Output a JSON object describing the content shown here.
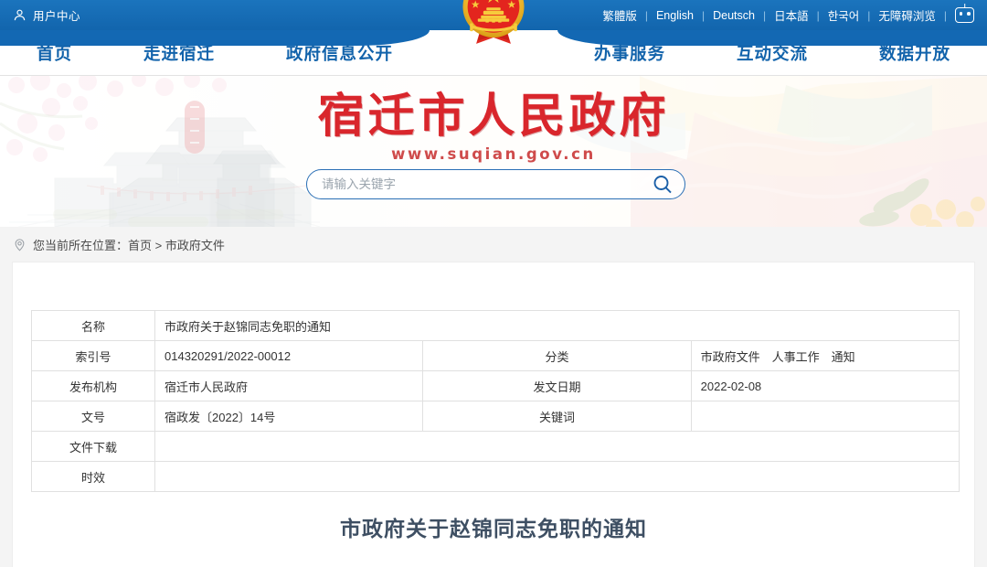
{
  "topbar": {
    "user_center": "用户中心",
    "user_icon": "user-icon",
    "languages": [
      {
        "label": "繁體版"
      },
      {
        "label": "English"
      },
      {
        "label": "Deutsch"
      },
      {
        "label": "日本語"
      },
      {
        "label": "한국어"
      },
      {
        "label": "无障碍浏览"
      }
    ],
    "separator": "|",
    "assistant_icon": "robot-icon"
  },
  "nav": {
    "left_items": [
      {
        "label": "首页"
      },
      {
        "label": "走进宿迁"
      },
      {
        "label": "政府信息公开"
      }
    ],
    "right_items": [
      {
        "label": "办事服务"
      },
      {
        "label": "互动交流"
      },
      {
        "label": "数据开放"
      }
    ],
    "emblem_icon": "national-emblem-icon"
  },
  "banner": {
    "site_title": "宿迁市人民政府",
    "site_url": "www.suqian.gov.cn",
    "seal_text": "项王故里"
  },
  "search": {
    "placeholder": "请输入关键字",
    "value": "",
    "icon": "search-icon"
  },
  "breadcrumb": {
    "pin_icon": "location-pin-icon",
    "prefix": "您当前所在位置：",
    "items": [
      {
        "label": "首页"
      },
      {
        "label": "市政府文件"
      }
    ],
    "separator": " > ",
    "full_text": "您当前所在位置：首页 > 市政府文件"
  },
  "document": {
    "title": "市政府关于赵锦同志免职的通知",
    "info_rows": [
      {
        "label1": "名称",
        "value1": "市政府关于赵锦同志免职的通知",
        "label2": "",
        "value2": "",
        "span": true
      },
      {
        "label1": "索引号",
        "value1": "014320291/2022-00012",
        "label2": "分类",
        "value2": "市政府文件　人事工作　通知",
        "span": false
      },
      {
        "label1": "发布机构",
        "value1": "宿迁市人民政府",
        "label2": "发文日期",
        "value2": "2022-02-08",
        "span": false
      },
      {
        "label1": "文号",
        "value1": "宿政发〔2022〕14号",
        "label2": "关键词",
        "value2": "",
        "span": false
      },
      {
        "label1": "文件下载",
        "value1": "",
        "label2": "",
        "value2": "",
        "span": true
      },
      {
        "label1": "时效",
        "value1": "",
        "label2": "",
        "value2": "",
        "span": true
      }
    ]
  },
  "colors": {
    "brand_blue": "#1368b3",
    "topbar_blue": "#1b74bd",
    "nav_text": "#1263ab",
    "title_red": "#d9262c",
    "page_bg": "#f4f4f4",
    "card_bg": "#ffffff",
    "table_border": "#e0e0e0",
    "doc_title": "#3e4f63"
  }
}
